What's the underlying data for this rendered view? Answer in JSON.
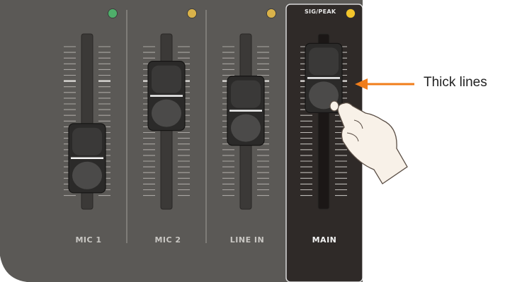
{
  "channels": [
    {
      "id": "mic1",
      "label": "MIC 1",
      "led_color": "#4fae6a",
      "fader_level": 0.22
    },
    {
      "id": "mic2",
      "label": "MIC 2",
      "led_color": "#d9b24a",
      "fader_level": 0.64
    },
    {
      "id": "linein",
      "label": "LINE IN",
      "led_color": "#d9b24a",
      "fader_level": 0.54
    },
    {
      "id": "main",
      "label": "MAIN",
      "led_color": "#f3c52b",
      "fader_level": 0.76,
      "selected": true
    }
  ],
  "sig_peak_label": "SIG/PEAK",
  "annotation": {
    "text": "Thick lines",
    "arrow_color": "#f07d1a"
  },
  "colors": {
    "panel": "#5b5956",
    "panel_selected": "#2f2a28",
    "label_text": "#c9c7c3",
    "label_selected": "#f4f4f4"
  }
}
